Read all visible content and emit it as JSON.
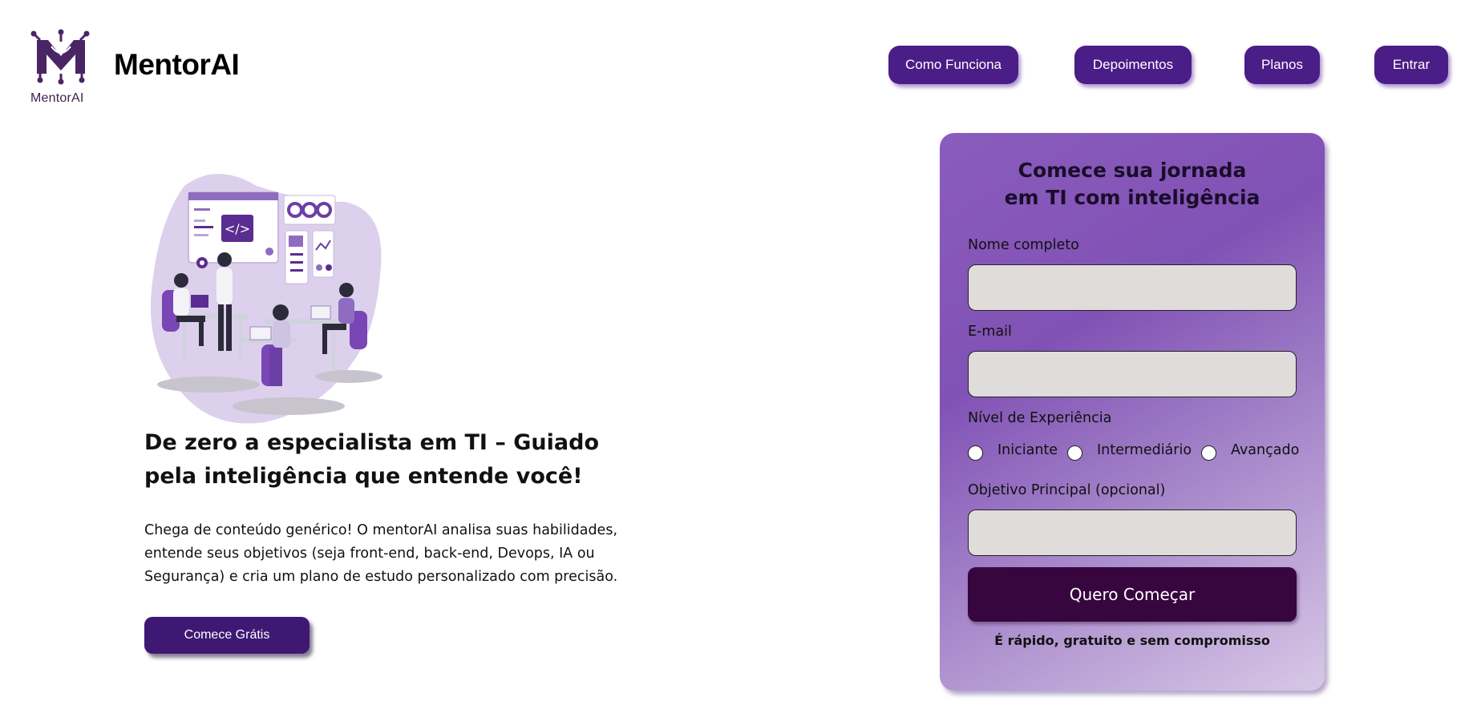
{
  "header": {
    "logo_caption": "MentorAI",
    "brand_name": "MentorAI",
    "nav": [
      {
        "label": "Como Funciona"
      },
      {
        "label": "Depoimentos"
      },
      {
        "label": "Planos"
      },
      {
        "label": "Entrar"
      }
    ],
    "accent_color": "#4b1d86"
  },
  "hero": {
    "illustration": "team-coding-illustration",
    "title": "De zero a especialista em TI – Guiado pela inteligência que entende você!",
    "description": "Chega de conteúdo genérico! O mentorAI analisa suas habilidades, entende seus objetivos (seja front-end, back-end, Devops, IA ou Segurança) e cria um plano de estudo personalizado com precisão.",
    "cta_label": "Comece Grátis"
  },
  "signup_form": {
    "title": "Comece sua jornada em TI com inteligência",
    "name_label": "Nome completo",
    "name_value": "",
    "email_label": "E-mail",
    "email_value": "",
    "level_label": "Nível de Experiência",
    "levels": [
      {
        "label": "Iniciante",
        "selected": false
      },
      {
        "label": "Intermediário",
        "selected": false
      },
      {
        "label": "Avançado",
        "selected": false
      }
    ],
    "goal_label": "Objetivo Principal (opcional)",
    "goal_value": "",
    "submit_label": "Quero Começar",
    "note": "É rápido, gratuito e sem compromisso",
    "submit_color": "#38063f"
  }
}
